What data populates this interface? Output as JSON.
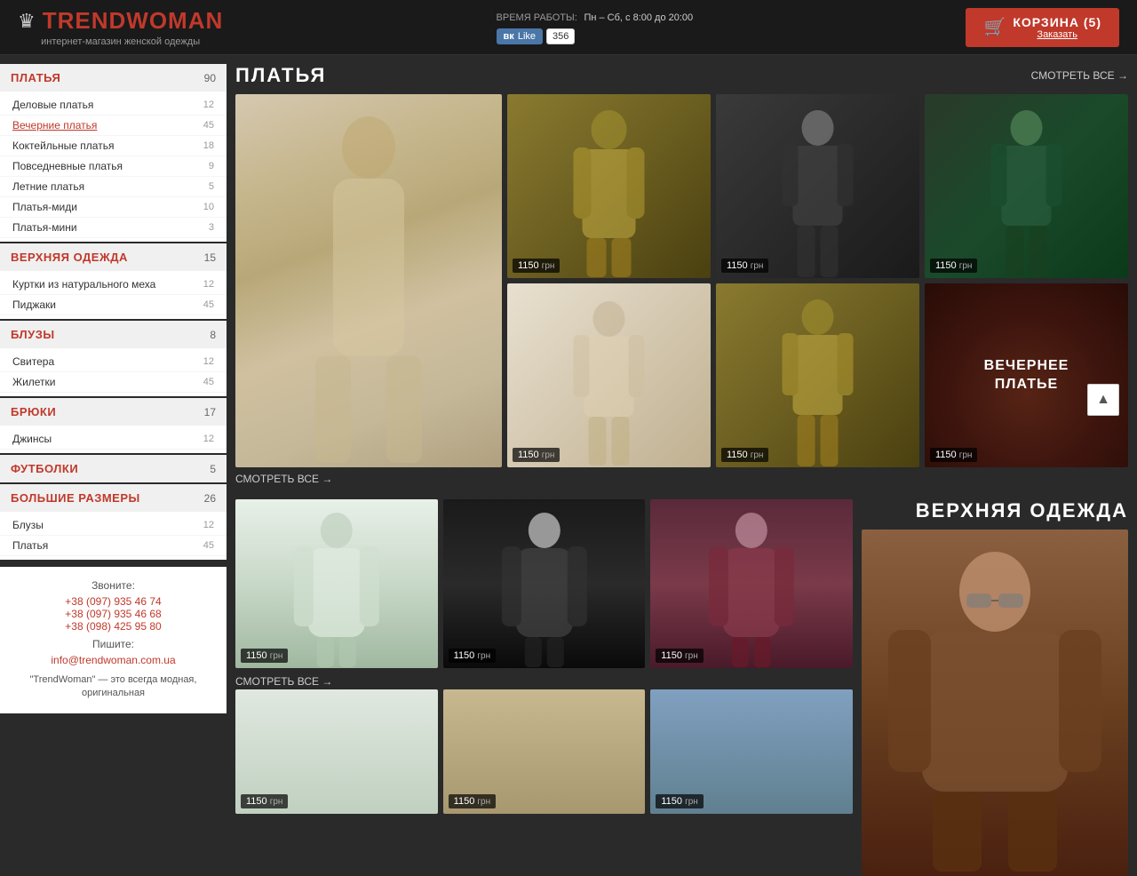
{
  "header": {
    "logo_crown": "♛",
    "logo_part1": "TREND",
    "logo_part2": "WOMAN",
    "logo_sub": "интернет-магазин женской одежды",
    "work_label": "ВРЕМЯ РАБОТЫ:",
    "work_hours": "Пн – Сб, с 8:00 до 20:00",
    "vk_label": "Like",
    "vk_count": "356",
    "cart_label": "КОРЗИНА (5)",
    "cart_order": "Заказать"
  },
  "sidebar": {
    "categories": [
      {
        "title": "ПЛАТЬЯ",
        "count": "90",
        "items": [
          {
            "label": "Деловые платья",
            "count": "12",
            "active": false
          },
          {
            "label": "Вечерние платья",
            "count": "45",
            "active": true
          },
          {
            "label": "Коктейльные платья",
            "count": "18",
            "active": false
          },
          {
            "label": "Повседневные платья",
            "count": "9",
            "active": false
          },
          {
            "label": "Летние платья",
            "count": "5",
            "active": false
          },
          {
            "label": "Платья-миди",
            "count": "10",
            "active": false
          },
          {
            "label": "Платья-мини",
            "count": "3",
            "active": false
          }
        ]
      },
      {
        "title": "ВЕРХНЯЯ ОДЕЖДА",
        "count": "15",
        "items": [
          {
            "label": "Куртки из натурального меха",
            "count": "12",
            "active": false
          },
          {
            "label": "Пиджаки",
            "count": "45",
            "active": false
          }
        ]
      },
      {
        "title": "БЛУЗЫ",
        "count": "8",
        "items": [
          {
            "label": "Свитера",
            "count": "12",
            "active": false
          },
          {
            "label": "Жилетки",
            "count": "45",
            "active": false
          }
        ]
      },
      {
        "title": "БРЮКИ",
        "count": "17",
        "items": [
          {
            "label": "Джинсы",
            "count": "12",
            "active": false
          }
        ]
      },
      {
        "title": "ФУТБОЛКИ",
        "count": "5",
        "items": []
      },
      {
        "title": "БОЛЬШИЕ РАЗМЕРЫ",
        "count": "26",
        "items": [
          {
            "label": "Блузы",
            "count": "12",
            "active": false
          },
          {
            "label": "Платья",
            "count": "45",
            "active": false
          }
        ]
      }
    ],
    "contact": {
      "call_label": "Звоните:",
      "phones": [
        "+38 (097) 935 46 74",
        "+38 (097) 935 46 68",
        "+38 (098) 425 95 80"
      ],
      "write_label": "Пишите:",
      "email": "info@trendwoman.com.ua",
      "description": "\"TrendWoman\" — это всегда модная, оригинальная"
    }
  },
  "dresses_section": {
    "title": "ПЛАТЬЯ",
    "view_all": "СМОТРЕТЬ ВСЕ →",
    "products": [
      {
        "price": "1150",
        "currency": "грн"
      },
      {
        "price": "1150",
        "currency": "грн"
      },
      {
        "price": "1150",
        "currency": "грн"
      },
      {
        "price": "1150",
        "currency": "грн"
      },
      {
        "price": "1150",
        "currency": "грн"
      },
      {
        "price": "1150",
        "currency": "грн"
      }
    ],
    "featured_label": "ВЕЧЕРНЕЕ\nПЛАТЬЕ"
  },
  "outerwear_section": {
    "title": "ВЕРХНЯЯ ОДЕЖДА",
    "view_all_bottom": "СМОТРЕТЬ ВСЕ →",
    "products": [
      {
        "price": "1150",
        "currency": "грн"
      },
      {
        "price": "1150",
        "currency": "грн"
      },
      {
        "price": "1150",
        "currency": "грн"
      }
    ]
  },
  "scroll_top": "▲"
}
